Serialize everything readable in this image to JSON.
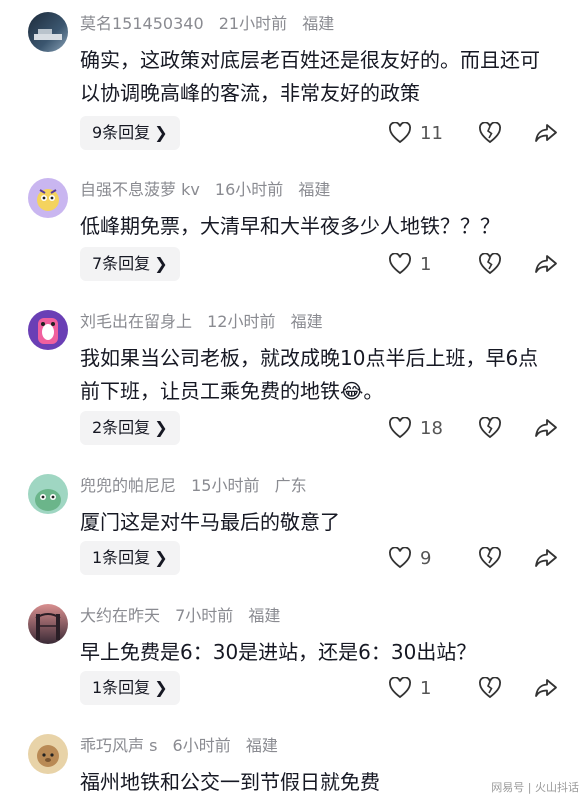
{
  "comments": [
    {
      "user": "莫名151450340",
      "time": "21小时前",
      "location": "福建",
      "text": "确实，这政策对底层老百姓还是很友好的。而且还可以协调晚高峰的客流，非常友好的政策",
      "replies": "9条回复",
      "likes": "11"
    },
    {
      "user": "自强不息菠萝 kv",
      "time": "16小时前",
      "location": "福建",
      "text": "低峰期免票，大清早和大半夜多少人地铁？？？",
      "replies": "7条回复",
      "likes": "1"
    },
    {
      "user": "刘毛出在留身上",
      "time": "12小时前",
      "location": "福建",
      "text": "我如果当公司老板，就改成晚10点半后上班，早6点前下班，让员工乘免费的地铁😂。",
      "replies": "2条回复",
      "likes": "18"
    },
    {
      "user": "兜兜的帕尼尼",
      "time": "15小时前",
      "location": "广东",
      "text": "厦门这是对牛马最后的敬意了",
      "replies": "1条回复",
      "likes": "9"
    },
    {
      "user": "大约在昨天",
      "time": "7小时前",
      "location": "福建",
      "text": "早上免费是6：30是进站，还是6：30出站？",
      "replies": "1条回复",
      "likes": "1"
    },
    {
      "user": "乖巧风声 s",
      "time": "6小时前",
      "location": "福建",
      "text": "福州地铁和公交一到节假日就免费",
      "replies": "",
      "likes": ""
    }
  ],
  "watermark": "网易号 | 火山抖话",
  "icons": {
    "like": "heart-outline-icon",
    "dislike": "broken-heart-icon",
    "share": "share-arrow-icon",
    "reply_chevron": "chevron-right-icon"
  }
}
